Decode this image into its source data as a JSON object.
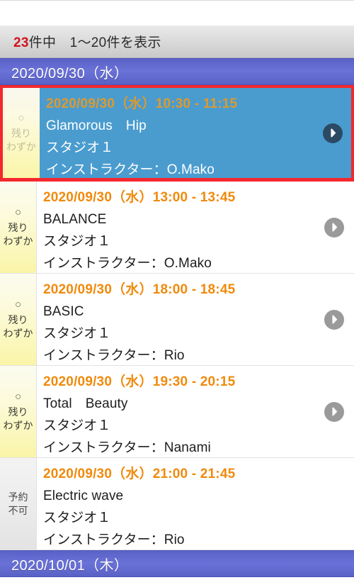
{
  "result_bar": {
    "count_number": "23",
    "count_suffix": "件中　1〜20件を表示"
  },
  "groups": [
    {
      "date_label": "2020/09/30（水）",
      "lessons": [
        {
          "selected": true,
          "status_mark": "○",
          "status_line1": "残り",
          "status_line2": "わずか",
          "status_type": "available",
          "time": "2020/09/30（水）10:30 - 11:15",
          "program": "Glamorous　Hip",
          "studio": "スタジオ１",
          "instructor": "インストラクター：O.Mako",
          "has_chevron": true
        },
        {
          "selected": false,
          "status_mark": "○",
          "status_line1": "残り",
          "status_line2": "わずか",
          "status_type": "available",
          "time": "2020/09/30（水）13:00 - 13:45",
          "program": "BALANCE",
          "studio": "スタジオ１",
          "instructor": "インストラクター：O.Mako",
          "has_chevron": true
        },
        {
          "selected": false,
          "status_mark": "○",
          "status_line1": "残り",
          "status_line2": "わずか",
          "status_type": "available",
          "time": "2020/09/30（水）18:00 - 18:45",
          "program": "BASIC",
          "studio": "スタジオ１",
          "instructor": "インストラクター：Rio",
          "has_chevron": true
        },
        {
          "selected": false,
          "status_mark": "○",
          "status_line1": "残り",
          "status_line2": "わずか",
          "status_type": "available",
          "time": "2020/09/30（水）19:30 - 20:15",
          "program": "Total　Beauty",
          "studio": "スタジオ１",
          "instructor": "インストラクター：Nanami",
          "has_chevron": true
        },
        {
          "selected": false,
          "status_mark": "",
          "status_line1": "予約",
          "status_line2": "不可",
          "status_type": "unavailable",
          "time": "2020/09/30（水）21:00 - 21:45",
          "program": "Electric wave",
          "studio": "スタジオ１",
          "instructor": "インストラクター：Rio",
          "has_chevron": false
        }
      ]
    },
    {
      "date_label": "2020/10/01（木）",
      "lessons": []
    }
  ],
  "colors": {
    "accent_time": "#f08a0c",
    "date_header_bg": "#6a72d8",
    "selected_border": "#f4282d",
    "selected_bg": "#4a9ccf",
    "status_available_bg": "#faf5a8",
    "status_unavailable_bg": "#e6e6e6",
    "count_number": "#d1121b"
  },
  "icons": {
    "chevron_right": "chevron-right-icon",
    "circle_mark": "circle-availability-icon"
  }
}
